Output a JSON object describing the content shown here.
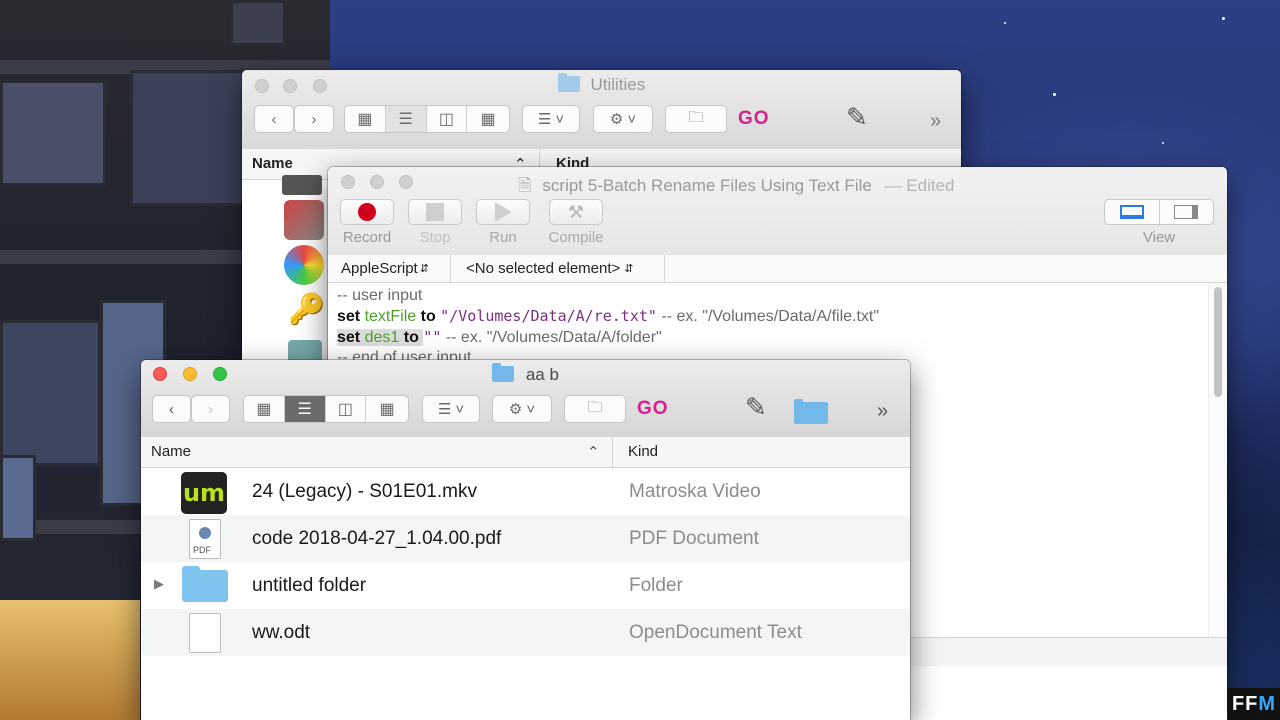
{
  "utilities_window": {
    "title": "Utilities",
    "go_label": "GO",
    "more_label": "»",
    "col_name": "Name",
    "col_kind": "Kind"
  },
  "editor_window": {
    "title": "script 5-Batch Rename Files Using Text File",
    "edited_label": "— Edited",
    "buttons": {
      "record": "Record",
      "stop": "Stop",
      "run": "Run",
      "compile": "Compile",
      "view": "View"
    },
    "language_select": "AppleScript",
    "element_select": "<No selected element>",
    "code": {
      "line1": "-- user input",
      "line2_kw1": "set",
      "line2_var": "textFile",
      "line2_kw2": "to",
      "line2_str": "\"/Volumes/Data/A/re.txt\"",
      "line2_cmt": "-- ex. \"/Volumes/Data/A/file.txt\"",
      "line3_kw1": "set",
      "line3_var": "des1",
      "line3_kw2": "to",
      "line3_str": "\"\"",
      "line3_cmt": "-- ex. \"/Volumes/Data/A/folder\"",
      "line4": "-- end of user input"
    }
  },
  "aab_window": {
    "title": "aa b",
    "go_label": "GO",
    "more_label": "»",
    "col_name": "Name",
    "col_kind": "Kind",
    "files": [
      {
        "name": "24 (Legacy) - S01E01.mkv",
        "kind": "Matroska Video",
        "icon": "um-video-icon"
      },
      {
        "name": "code 2018-04-27_1.04.00.pdf",
        "kind": "PDF Document",
        "icon": "pdf-icon"
      },
      {
        "name": "untitled folder",
        "kind": "Folder",
        "icon": "folder-icon"
      },
      {
        "name": "ww.odt",
        "kind": "OpenDocument Text",
        "icon": "document-icon"
      }
    ],
    "pdf_badge": "PDF",
    "um_badge": "um"
  },
  "watermark": {
    "prefix": "FF",
    "accent": "M"
  },
  "colors": {
    "go": "#d6208f",
    "folder": "#72b8e8",
    "record": "#d0021b",
    "string": "#7d2e86",
    "variable": "#4f9e2a"
  }
}
